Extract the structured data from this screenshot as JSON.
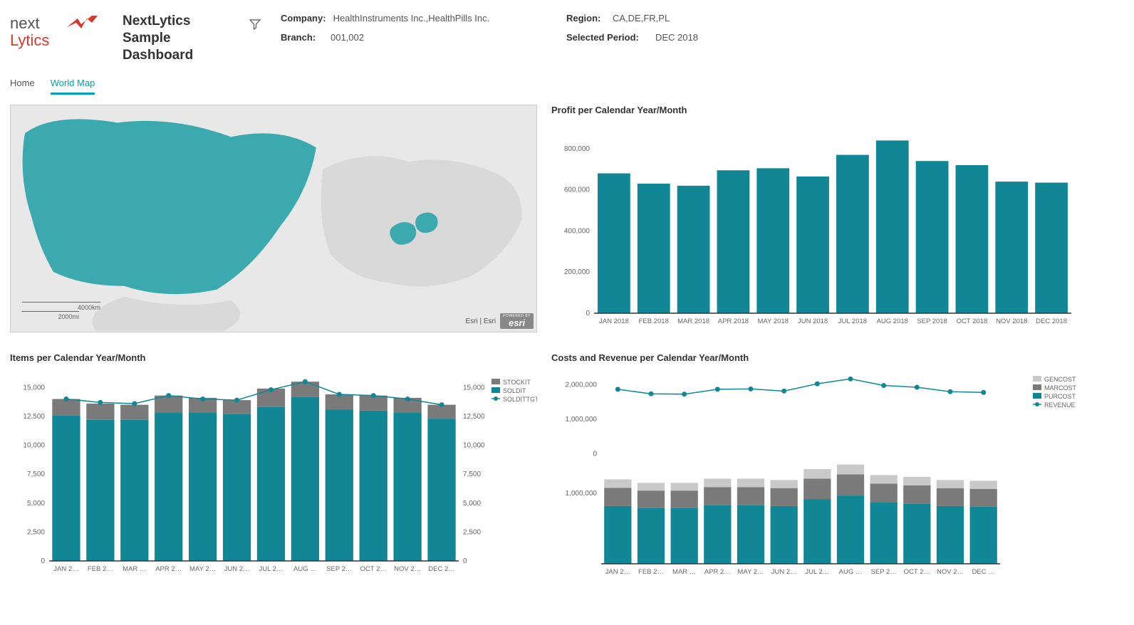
{
  "header": {
    "title": "NextLytics Sample Dashboard",
    "filters": {
      "company": {
        "label": "Company:",
        "value": "HealthInstruments Inc.,HealthPills Inc."
      },
      "branch": {
        "label": "Branch:",
        "value": "001,002"
      },
      "region": {
        "label": "Region:",
        "value": "CA,DE,FR,PL"
      },
      "period": {
        "label": "Selected Period:",
        "value": "DEC 2018"
      }
    }
  },
  "tabs": [
    {
      "label": "Home",
      "active": false
    },
    {
      "label": "World Map",
      "active": true
    }
  ],
  "map": {
    "scale_km": "4000km",
    "scale_mi": "2000mi",
    "attribution": "Esri | Esri",
    "powered_by": "POWERED BY",
    "esri": "esri"
  },
  "charts": {
    "profit": {
      "title": "Profit per Calendar Year/Month"
    },
    "items": {
      "title": "Items per Calendar Year/Month"
    },
    "costs": {
      "title": "Costs and Revenue per Calendar Year/Month"
    }
  },
  "chart_data": [
    {
      "id": "profit",
      "type": "bar",
      "title": "Profit per Calendar Year/Month",
      "categories": [
        "JAN 2018",
        "FEB 2018",
        "MAR 2018",
        "APR 2018",
        "MAY 2018",
        "JUN 2018",
        "JUL 2018",
        "AUG 2018",
        "SEP 2018",
        "OCT 2018",
        "NOV 2018",
        "DEC 2018"
      ],
      "values": [
        680000,
        630000,
        620000,
        695000,
        705000,
        665000,
        770000,
        840000,
        740000,
        720000,
        640000,
        635000
      ],
      "ylabel": "",
      "xlabel": "",
      "ylim": [
        0,
        900000
      ],
      "yticks": [
        0,
        200000,
        400000,
        600000,
        800000
      ]
    },
    {
      "id": "items",
      "type": "bar+line",
      "title": "Items per Calendar Year/Month",
      "categories": [
        "JAN 2…",
        "FEB 2…",
        "MAR …",
        "APR 2…",
        "MAY 2…",
        "JUN 2…",
        "JUL 2…",
        "AUG …",
        "SEP 2…",
        "OCT 2…",
        "NOV 2…",
        "DEC 2…"
      ],
      "series": [
        {
          "name": "STOCKIT",
          "type": "bar",
          "color": "#7a7a7a",
          "values": [
            1400,
            1400,
            1300,
            1500,
            1300,
            1200,
            1600,
            1300,
            1300,
            1300,
            1300,
            1200
          ]
        },
        {
          "name": "SOLDIT",
          "type": "bar",
          "color": "#118796",
          "values": [
            12600,
            12200,
            12200,
            12800,
            12800,
            12700,
            13300,
            14200,
            13100,
            13000,
            12800,
            12300
          ]
        },
        {
          "name": "SOLDITTGT",
          "type": "line",
          "color": "#118796",
          "values": [
            14000,
            13700,
            13600,
            14300,
            14000,
            13900,
            14800,
            15500,
            14400,
            14300,
            14000,
            13500
          ]
        }
      ],
      "ylim": [
        0,
        16000
      ],
      "yticks": [
        0,
        2500,
        5000,
        7500,
        10000,
        12500,
        15000
      ],
      "dual_axis": true
    },
    {
      "id": "costs",
      "type": "bar+line",
      "title": "Costs and Revenue per Calendar Year/Month",
      "categories": [
        "JAN 2…",
        "FEB 2…",
        "MAR …",
        "APR 2…",
        "MAY 2…",
        "JUN 2…",
        "JUL 2…",
        "AUG …",
        "SEP 2…",
        "OCT 2…",
        "NOV 2…",
        "DEC …"
      ],
      "series": [
        {
          "name": "GENCOST",
          "type": "bar",
          "color": "#c9c9c9",
          "values": [
            120000,
            110000,
            110000,
            120000,
            120000,
            115000,
            135000,
            140000,
            120000,
            120000,
            115000,
            115000
          ]
        },
        {
          "name": "MARCOST",
          "type": "bar",
          "color": "#7a7a7a",
          "values": [
            260000,
            250000,
            250000,
            260000,
            260000,
            255000,
            290000,
            300000,
            270000,
            265000,
            255000,
            255000
          ]
        },
        {
          "name": "PURCOST",
          "type": "bar",
          "color": "#118796",
          "values": [
            820000,
            790000,
            790000,
            830000,
            830000,
            820000,
            920000,
            970000,
            870000,
            850000,
            820000,
            810000
          ]
        },
        {
          "name": "REVENUE",
          "type": "line",
          "color": "#118796",
          "values": [
            1870000,
            1740000,
            1730000,
            1870000,
            1880000,
            1820000,
            2030000,
            2170000,
            1980000,
            1930000,
            1800000,
            1780000
          ]
        }
      ],
      "ylim_top": [
        0,
        2300000
      ],
      "yticks_top": [
        0,
        1000000,
        2000000
      ],
      "ylim_bot": [
        0,
        1500000
      ],
      "yticks_bot": [
        1000000
      ]
    }
  ],
  "colors": {
    "teal": "#118796",
    "grey": "#7a7a7a",
    "lightgrey": "#c9c9c9",
    "mapland": "#d9d9d9",
    "maphighlight": "#3ba9ae"
  }
}
